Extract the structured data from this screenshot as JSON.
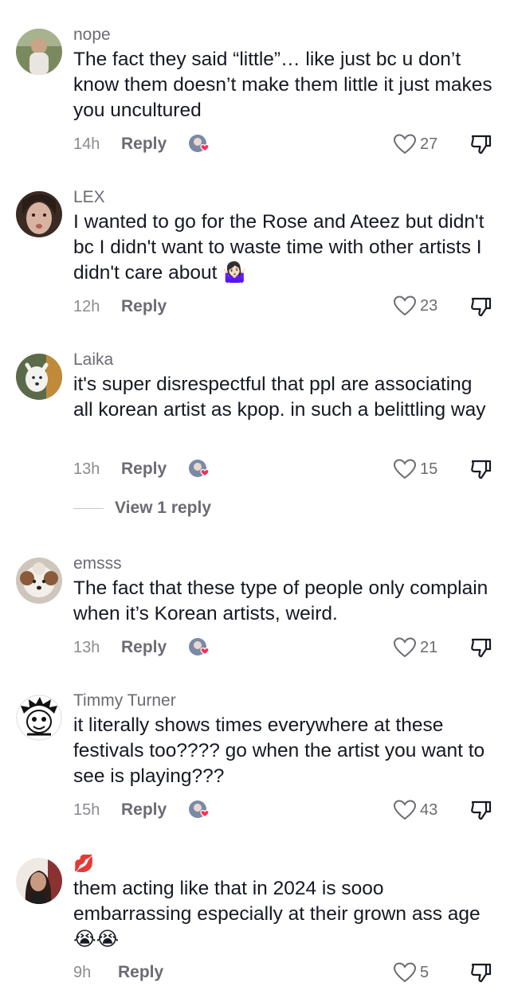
{
  "comments": [
    {
      "username": "nope",
      "text": "The fact they said “little”… like just bc u don’t know them doesn’t make them little it just makes you uncultured",
      "time": "14h",
      "reply": "Reply",
      "likes": "27",
      "avatar_icon": "avatar-photo-person-outdoors",
      "creator_liked": true
    },
    {
      "username": "LEX",
      "text": "I wanted to go for the Rose and Ateez but didn't bc I didn't want to waste time with other artists I didn't care about",
      "emoji": "🤷🏻‍♀️",
      "time": "12h",
      "reply": "Reply",
      "likes": "23",
      "avatar_icon": "avatar-photo-selfie",
      "creator_liked": false
    },
    {
      "username": "Laika",
      "text": "it's super disrespectful that ppl are associating all korean artist as kpop. in such a belittling way",
      "time": "13h",
      "reply": "Reply",
      "likes": "15",
      "view_replies": "View 1 reply",
      "avatar_icon": "avatar-photo-white-dog",
      "creator_liked": true
    },
    {
      "username": "emsss",
      "text": "The fact that these type of people only complain when it’s Korean artists, weird.",
      "time": "13h",
      "reply": "Reply",
      "likes": "21",
      "avatar_icon": "avatar-photo-curly-dog",
      "creator_liked": true
    },
    {
      "username": "Timmy Turner",
      "text": "it literally shows times everywhere at these festivals too???? go when the artist you want to see is playing???",
      "time": "15h",
      "reply": "Reply",
      "likes": "43",
      "avatar_icon": "avatar-drawing-cartoon",
      "creator_liked": true
    },
    {
      "username": "💋",
      "text": "them acting like that in 2024 is sooo embarrassing especially at their grown ass age",
      "emoji": "😭😭",
      "time": "9h",
      "reply": "Reply",
      "likes": "5",
      "avatar_icon": "avatar-photo-woman",
      "creator_liked": false
    }
  ],
  "icons": {
    "like": "heart-outline-icon",
    "dislike": "thumbs-down-icon",
    "creator_like": "creator-liked-avatar-heart-icon"
  },
  "colors": {
    "text": "#161823",
    "secondary": "#6b6b73",
    "heart_badge": "#fe2c55"
  }
}
